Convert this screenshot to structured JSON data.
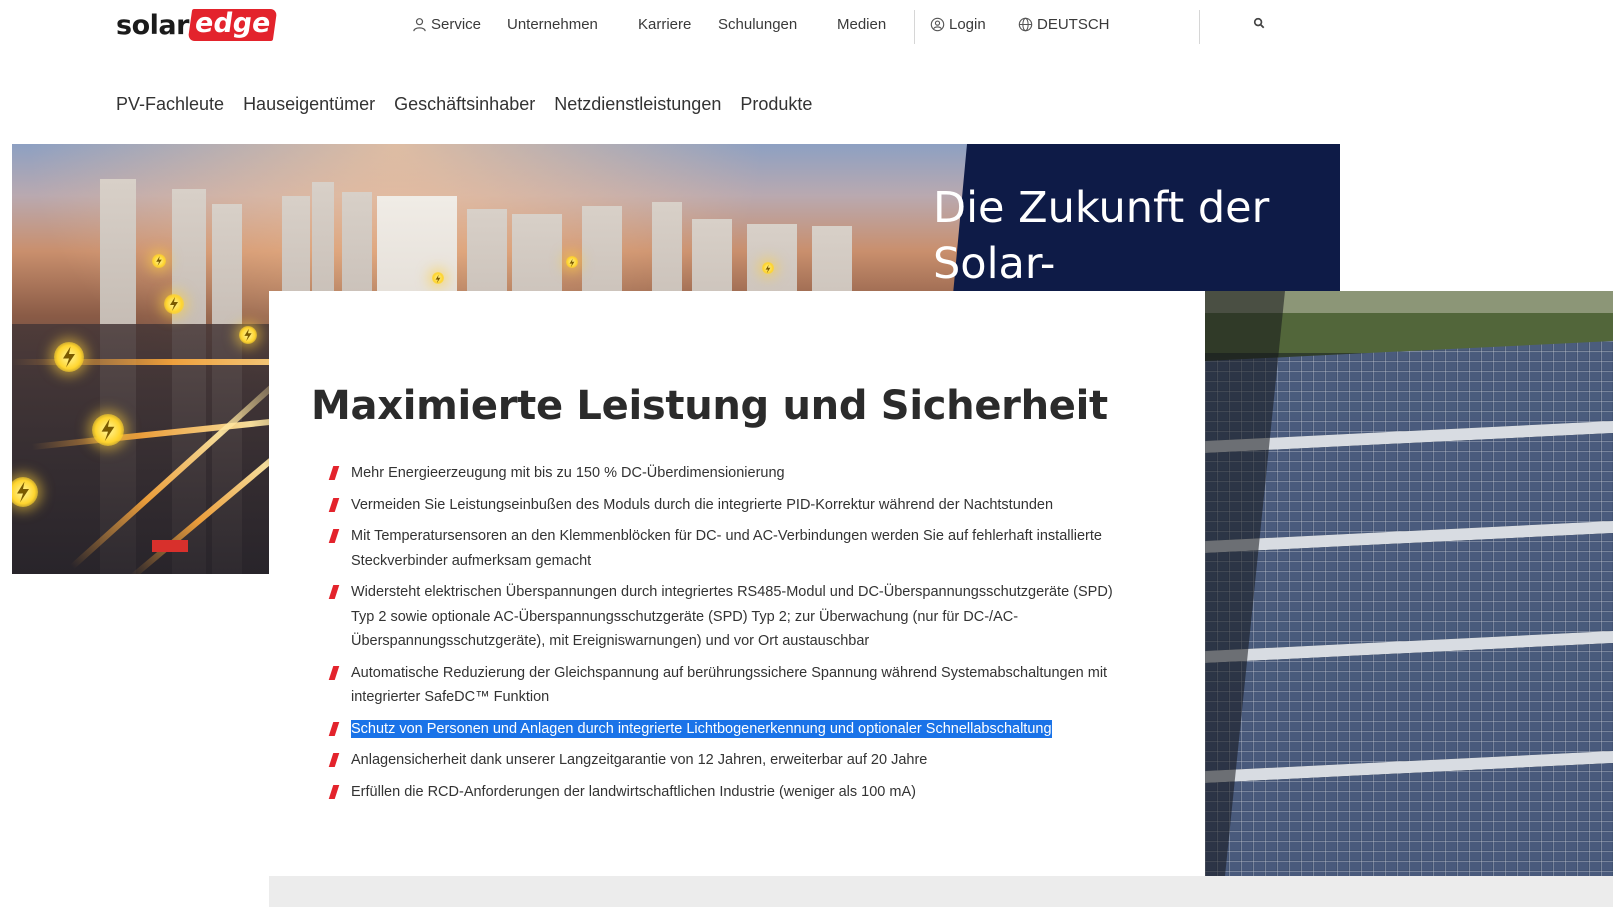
{
  "logo": {
    "part1": "solar",
    "part2": "edge"
  },
  "topnav": {
    "service": "Service",
    "company": "Unternehmen",
    "careers": "Karriere",
    "trainings": "Schulungen",
    "media": "Medien",
    "login": "Login",
    "language": "DEUTSCH"
  },
  "subnav": [
    "PV-Fachleute",
    "Hauseigentümer",
    "Geschäftsinhaber",
    "Netzdienstleistungen",
    "Produkte"
  ],
  "hero": {
    "title_line1": "Die Zukunft der",
    "title_line2": "Solar-"
  },
  "card": {
    "title": "Maximierte Leistung und Sicherheit",
    "features": [
      "Mehr Energieerzeugung mit bis zu 150 % DC-Überdimensionierung",
      "Vermeiden Sie Leistungseinbußen des Moduls durch die integrierte PID-Korrektur während der Nachtstunden",
      "Mit Temperatursensoren an den Klemmenblöcken für DC- und AC-Verbindungen werden Sie auf fehlerhaft installierte Steckverbinder aufmerksam gemacht",
      "Widersteht elektrischen Überspannungen durch integriertes RS485-Modul und DC-Überspannungsschutzgeräte (SPD) Typ 2 sowie optionale AC-Überspannungsschutzgeräte (SPD) Typ 2; zur Überwachung (nur für DC-/AC-Überspannungsschutzgeräte), mit Ereigniswarnungen) und vor Ort austauschbar",
      "Automatische Reduzierung der Gleichspannung auf berührungssichere Spannung während Systemabschaltungen mit integrierter SafeDC™ Funktion",
      "Schutz von Personen und Anlagen durch integrierte Lichtbogenerkennung und optionaler Schnellabschaltung",
      "Anlagensicherheit dank unserer Langzeitgarantie von 12 Jahren, erweiterbar auf 20 Jahre",
      "Erfüllen die RCD-Anforderungen der landwirtschaftlichen Industrie (weniger als 100 mA)"
    ],
    "selected_index": 5
  },
  "colors": {
    "brand_red": "#e3232c",
    "hero_navy": "#0e1b47",
    "selection_blue": "#1a73e8"
  },
  "icons": {
    "service": "user-icon",
    "login": "user-circle-icon",
    "language": "globe-icon",
    "search": "search-icon",
    "bullet": "red-slash-bullet"
  }
}
